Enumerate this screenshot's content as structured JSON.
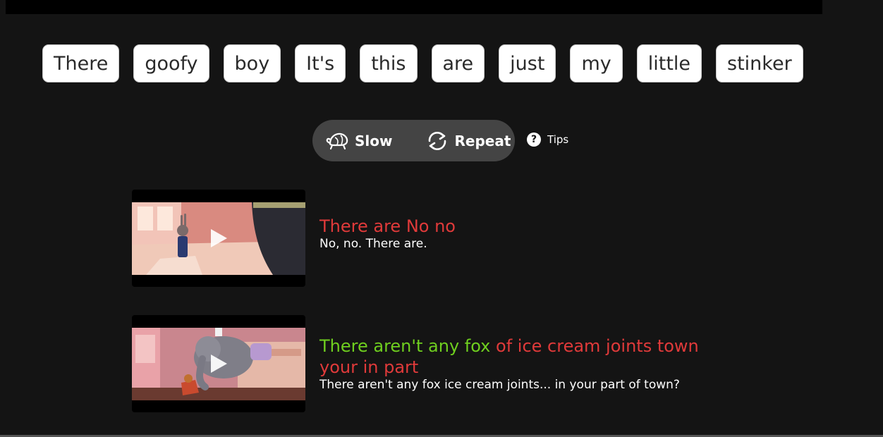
{
  "word_bank": [
    "There",
    "goofy",
    "boy",
    "It's",
    "this",
    "are",
    "just",
    "my",
    "little",
    "stinker"
  ],
  "controls": {
    "slow_label": "Slow",
    "repeat_label": "Repeat",
    "tips_label": "Tips",
    "slow_icon": "turtle-icon",
    "repeat_icon": "repeat-icon",
    "tips_icon": "question-icon"
  },
  "clips": [
    {
      "guess_correct": "",
      "guess_wrong": "There are No no",
      "answer": "No, no. There are."
    },
    {
      "guess_correct": "There aren't any fox ",
      "guess_wrong": "of ice cream joints town your in part",
      "answer": "There aren't any fox ice cream joints... in your part of town?"
    }
  ],
  "colors": {
    "background": "#141414",
    "correct": "#6fcf1f",
    "wrong": "#e03a3a",
    "pill": "#444444"
  }
}
